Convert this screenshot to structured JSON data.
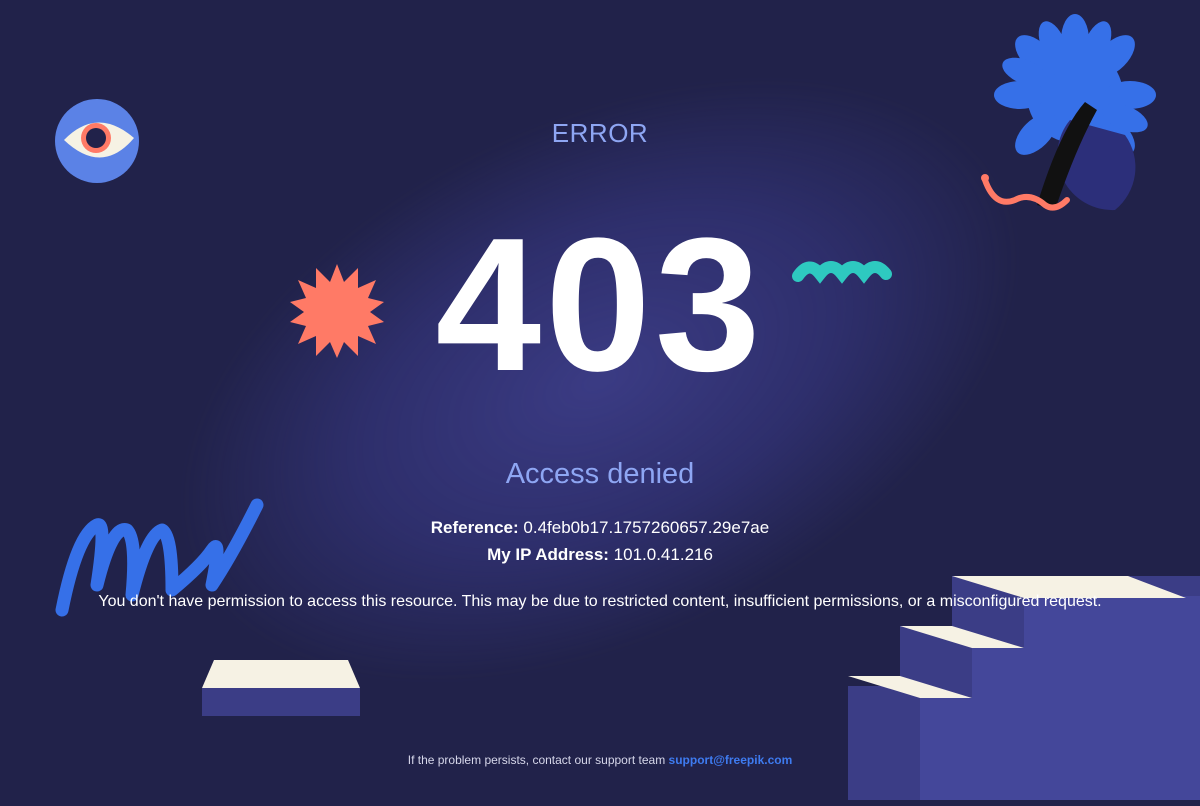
{
  "header": {
    "label": "ERROR"
  },
  "error": {
    "code": "403",
    "title": "Access denied"
  },
  "details": {
    "reference_label": "Reference:",
    "reference_value": "0.4feb0b17.1757260657.29e7ae",
    "ip_label": "My IP Address:",
    "ip_value": "101.0.41.216"
  },
  "message": "You don't have permission to access this resource. This may be due to restricted content, insufficient permissions, or a misconfigured request.",
  "footer": {
    "text": "If the problem persists, contact our support team ",
    "email": "support@freepik.com"
  },
  "colors": {
    "background": "#21224a",
    "accent_text": "#8ea6f3",
    "link": "#3e7bf0",
    "coral": "#ff7a66",
    "teal": "#2ec9c0",
    "blue": "#3670e8"
  },
  "decorations": [
    "eye-icon",
    "starburst-icon",
    "squiggle-icon",
    "flower-icon",
    "scribble-icon",
    "pedestal-icon",
    "stairs-icon"
  ]
}
